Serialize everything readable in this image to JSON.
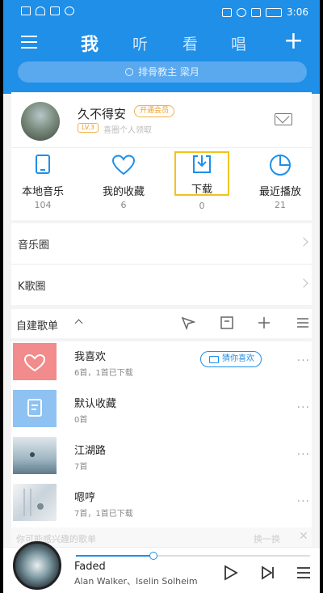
{
  "status": {
    "time": "3:06"
  },
  "header": {
    "tabs": [
      {
        "label": "我",
        "active": true
      },
      {
        "label": "听"
      },
      {
        "label": "看"
      },
      {
        "label": "唱"
      }
    ],
    "search_placeholder": "排骨教主 梁月"
  },
  "profile": {
    "username": "久不得安",
    "vip_badge": "开通会员",
    "level": "LV.3",
    "subtitle": "喜圈个人领取"
  },
  "quick": [
    {
      "label": "本地音乐",
      "count": "104",
      "icon": "phone-icon"
    },
    {
      "label": "我的收藏",
      "count": "6",
      "icon": "heart-icon"
    },
    {
      "label": "下载",
      "count": "0",
      "icon": "download-icon"
    },
    {
      "label": "最近播放",
      "count": "21",
      "icon": "clock-icon"
    }
  ],
  "rows": [
    {
      "label": "音乐圈"
    },
    {
      "label": "K歌圈"
    }
  ],
  "playlists_header": {
    "label": "自建歌单"
  },
  "playlists": [
    {
      "name": "我喜欢",
      "meta": "6首，1首已下载",
      "cover": "heart-cover",
      "extra": "猜你喜欢"
    },
    {
      "name": "默认收藏",
      "meta": "0首",
      "cover": "doc-cover"
    },
    {
      "name": "江湖路",
      "meta": "7首",
      "cover": "photo-cover"
    },
    {
      "name": "嗯哼",
      "meta": "7首，1首已下载",
      "cover": "photo-cover"
    }
  ],
  "recommend_bar": {
    "text": "你可能感兴趣的歌单",
    "refresh": "换一换"
  },
  "player": {
    "song": "Faded",
    "artist": "Alan Walker、Iselin Solheim",
    "progress": 0.33
  },
  "colors": {
    "accent": "#1f8fe8",
    "highlight": "#f0c419"
  }
}
